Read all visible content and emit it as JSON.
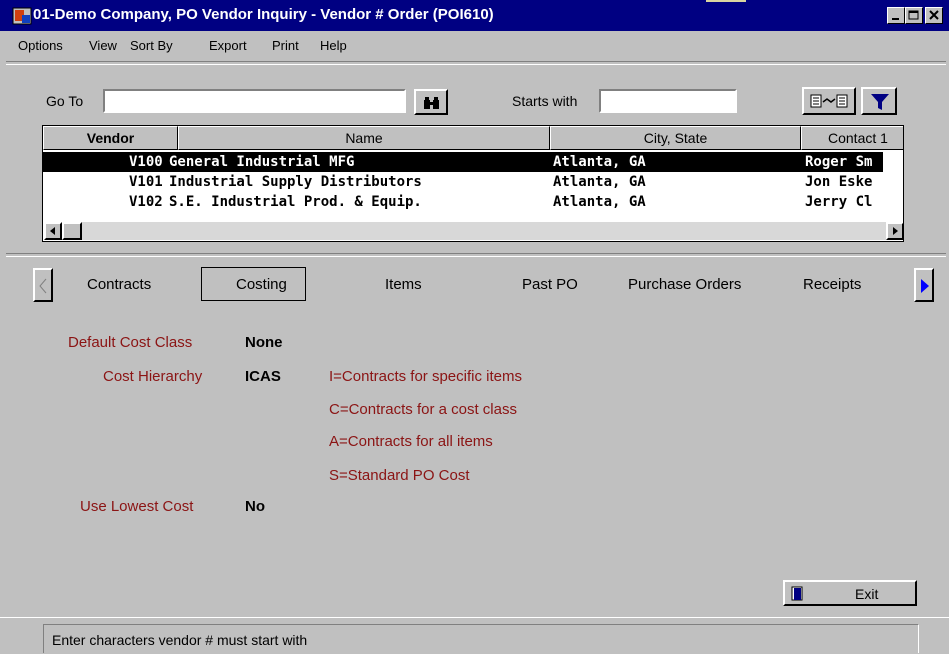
{
  "window": {
    "title": "01-Demo Company, PO Vendor Inquiry - Vendor # Order (POI610)"
  },
  "menu": [
    "Options",
    "View",
    "Sort By",
    "Export",
    "Print",
    "Help"
  ],
  "search": {
    "goto_label": "Go To",
    "goto_value": "",
    "starts_with_label": "Starts with",
    "starts_with_value": ""
  },
  "grid": {
    "columns": [
      "Vendor",
      "Name",
      "City, State",
      "Contact 1"
    ],
    "rows": [
      {
        "vendor": "V100",
        "name": "General Industrial MFG",
        "city": "Atlanta, GA",
        "contact": "Roger Sm"
      },
      {
        "vendor": "V101",
        "name": "Industrial Supply Distributors",
        "city": "Atlanta, GA",
        "contact": "Jon Eske"
      },
      {
        "vendor": "V102",
        "name": "S.E. Industrial Prod. & Equip.",
        "city": "Atlanta, GA",
        "contact": "Jerry Cl"
      }
    ],
    "selected_row": 0
  },
  "tabs": {
    "items": [
      "Contracts",
      "Costing",
      "Items",
      "Past PO",
      "Purchase Orders",
      "Receipts"
    ],
    "active": "Costing"
  },
  "costing": {
    "default_cost_class_label": "Default Cost Class",
    "default_cost_class_value": "None",
    "cost_hierarchy_label": "Cost Hierarchy",
    "cost_hierarchy_value": "ICAS",
    "hierarchy_legend": [
      "I=Contracts for specific items",
      "C=Contracts for a cost class",
      "A=Contracts for all items",
      "S=Standard PO Cost"
    ],
    "use_lowest_cost_label": "Use Lowest Cost",
    "use_lowest_cost_value": "No"
  },
  "buttons": {
    "exit": "Exit"
  },
  "status": {
    "message": "Enter characters vendor # must start with"
  },
  "colors": {
    "title_bar": "#000082",
    "label_text": "#8b1414",
    "selection": "#000000",
    "nav_arrow": "#0000ff"
  }
}
